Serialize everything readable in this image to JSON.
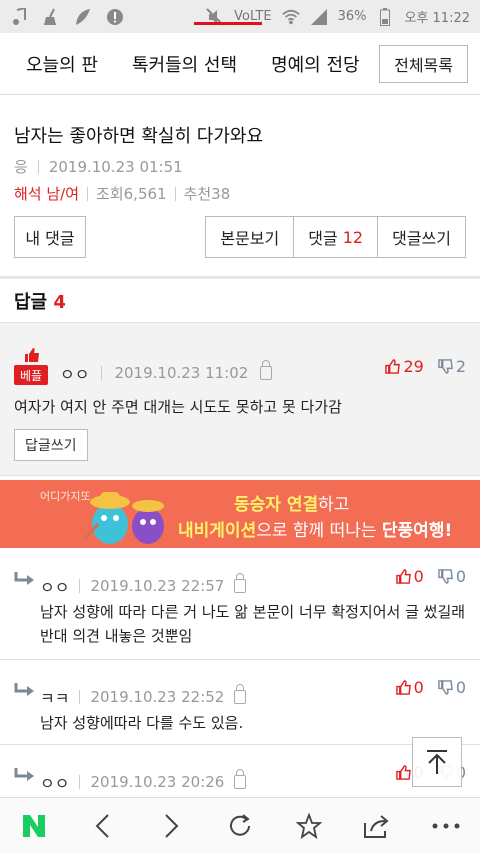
{
  "status_bar": {
    "battery_percent": "36%",
    "time": "오후 11:22",
    "network": "VoLTE"
  },
  "nav": {
    "tabs": [
      "오늘의 판",
      "톡커들의 선택",
      "명예의 전당"
    ],
    "all_list": "전체목록"
  },
  "post": {
    "title": "남자는 좋아하면 확실히 다가와요",
    "author": "응",
    "date": "2019.10.23 01:51",
    "category": "해석 남/여",
    "views": "조회6,561",
    "recommends": "추천38"
  },
  "buttons": {
    "my_comments": "내 댓글",
    "view_post": "본문보기",
    "comments_label": "댓글",
    "comments_count": "12",
    "write_comment": "댓글쓰기"
  },
  "replies": {
    "label": "답글",
    "count": "4"
  },
  "best_comment": {
    "badge": "베플",
    "author": "ㅇㅇ",
    "date": "2019.10.23 11:02",
    "up": "29",
    "down": "2",
    "text": "여자가 여지 안 주면 대개는 시도도 못하고 못 다가감",
    "reply_button": "답글쓰기"
  },
  "banner": {
    "brand": "어디가지또",
    "line1_highlight": "동승자 연결",
    "line1_rest": "하고",
    "line2_highlight": "내비게이션",
    "line2_mid": "으로 함께 떠나는 ",
    "line2_end": "단풍여행!"
  },
  "sub_comments": [
    {
      "author": "ㅇㅇ",
      "date": "2019.10.23 22:57",
      "up": "0",
      "down": "0",
      "text": "남자 성향에 따라 다른 거 나도 앎 본문이 너무 확정지어서 글 썼길래 반대 의견 내놓은 것뿐임"
    },
    {
      "author": "ㅋㅋ",
      "date": "2019.10.23 22:52",
      "up": "0",
      "down": "0",
      "text": "남자 성향에따라 다를 수도 있음."
    },
    {
      "author": "ㅇㅇ",
      "date": "2019.10.23 20:26",
      "up": "0",
      "down": "0",
      "text": ""
    }
  ],
  "colors": {
    "accent": "#e02020",
    "banner": "#f36d54",
    "naver_green": "#19ce60"
  }
}
